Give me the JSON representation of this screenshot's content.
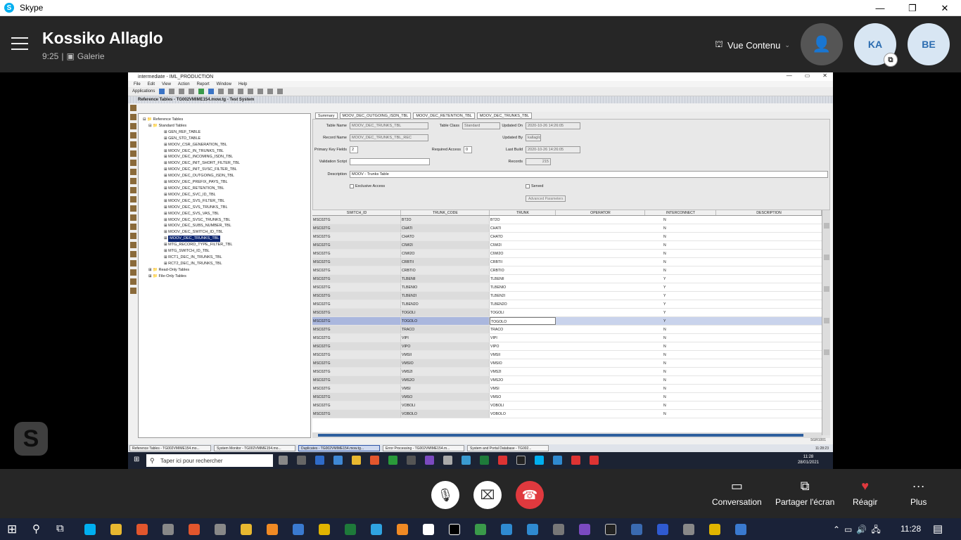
{
  "window": {
    "app_name": "Skype",
    "minimize": "—",
    "maximize": "❐",
    "close": "✕"
  },
  "call": {
    "caller": "Kossiko Allaglo",
    "time": "9:25",
    "view": "Galerie",
    "content_view": "Vue Contenu",
    "avatars": [
      "KA",
      "BE"
    ]
  },
  "shared_app": {
    "title": "intermediate - IML_PRODUCTION",
    "menu": [
      "File",
      "Edit",
      "View",
      "Action",
      "Report",
      "Window",
      "Help"
    ],
    "toolbar_label": "Applications",
    "doc_title": "Reference Tables - TG002VMIME154.mow.tg - Test System",
    "tree": {
      "root": "Reference Tables",
      "group": "Standard Tables",
      "items": [
        "GEN_REF_TABLE",
        "GEN_STD_TABLE",
        "MOOV_CSR_GENERATION_TBL",
        "MOOV_DEC_IN_TRUNKS_TBL",
        "MOOV_DEC_INCOMING_ISDN_TBL",
        "MOOV_DEC_INIT_SHORT_FILTER_TBL",
        "MOOV_DEC_INIT_SVSC_FILTER_TBL",
        "MOOV_DEC_OUTGOING_ISDN_TBL",
        "MOOV_DEC_PREFIX_PAYS_TBL",
        "MOOV_DEC_RETENTION_TBL",
        "MOOV_DEC_SVC_ID_TBL",
        "MOOV_DEC_SVS_FILTER_TBL",
        "MOOV_DEC_SVS_TRUNKS_TBL",
        "MOOV_DEC_SVS_VAS_TBL",
        "MOOV_DEC_SVSC_TRUNKS_TBL",
        "MOOV_DEC_SUBS_NUMBER_TBL",
        "MOOV_DEC_SWITCH_ID_TBL",
        "MOOV_DEC_TRUNKS_TBL",
        "MTG_RECORD_TYPE_FILTER_TBL",
        "MTG_SWITCH_ID_TBL",
        "RCT1_DEC_IN_TRUNKS_TBL",
        "RCT2_DEC_IN_TRUNKS_TBL"
      ],
      "selected_index": 17,
      "other_groups": [
        "Read-Only Tables",
        "File-Only Tables"
      ]
    },
    "tabs": [
      "Summary",
      "MOOV_DEC_OUTGOING_ISDN_TBL",
      "MOOV_DEC_RETENTION_TBL",
      "MOOV_DEC_TRUNKS_TBL"
    ],
    "form": {
      "table_name_label": "Table Name",
      "table_name": "MOOV_DEC_TRUNKS_TBL",
      "table_class_label": "Table Class",
      "table_class": "Standard",
      "updated_on_label": "Updated On",
      "updated_on": "2020-10-26 14:26:05",
      "record_name_label": "Record Name",
      "record_name": "MOOV_DEC_TRUNKS_TBL_REC",
      "updated_by_label": "Updated By",
      "updated_by": "kallaglo",
      "pk_label": "Primary Key Fields",
      "pk": "2",
      "required_access_label": "Required Access",
      "required_access": "0",
      "last_build_label": "Last Build",
      "last_build": "2020-10-26 14:26:05",
      "validation_label": "Validation Script",
      "validation": "",
      "records_label": "Records",
      "records": "215",
      "description_label": "Description",
      "description": "MOOV - Trunks Table",
      "exclusive_label": "Exclusive Access",
      "served_label": "Served",
      "advanced_label": "Advanced Parameters"
    },
    "grid": {
      "columns": [
        "SWITCH_ID",
        "TRUNK_CODE",
        "TRUNK",
        "OPERATOR",
        "INTERCONNECT",
        "DESCRIPTION"
      ],
      "rows": [
        [
          "MSC02TG",
          "BT2O",
          "BT2O",
          "",
          "N",
          ""
        ],
        [
          "MSC02TG",
          "CHATI",
          "CHATI",
          "",
          "N",
          ""
        ],
        [
          "MSC02TG",
          "CHATO",
          "CHATO",
          "",
          "N",
          ""
        ],
        [
          "MSC02TG",
          "CIWI2I",
          "CIWI2I",
          "",
          "N",
          ""
        ],
        [
          "MSC02TG",
          "CIWI2O",
          "CIWI2O",
          "",
          "N",
          ""
        ],
        [
          "MSC02TG",
          "CRBTII",
          "CRBTII",
          "",
          "N",
          ""
        ],
        [
          "MSC02TG",
          "CRBTIO",
          "CRBTIO",
          "",
          "N",
          ""
        ],
        [
          "MSC02TG",
          "TLBENII",
          "TLBENII",
          "",
          "Y",
          ""
        ],
        [
          "MSC02TG",
          "TLBENIO",
          "TLBENIO",
          "",
          "Y",
          ""
        ],
        [
          "MSC02TG",
          "TLBEN2I",
          "TLBEN2I",
          "",
          "Y",
          ""
        ],
        [
          "MSC02TG",
          "TLBEN2O",
          "TLBEN2O",
          "",
          "Y",
          ""
        ],
        [
          "MSC02TG",
          "TOGOLI",
          "TOGOLI",
          "",
          "Y",
          ""
        ],
        [
          "MSC02TG",
          "TOGOLO",
          "TOGOLO",
          "",
          "Y",
          ""
        ],
        [
          "MSC02TG",
          "TRACO",
          "TRACO",
          "",
          "N",
          ""
        ],
        [
          "MSC02TG",
          "VIPI",
          "VIPI",
          "",
          "N",
          ""
        ],
        [
          "MSC02TG",
          "VIPO",
          "VIPO",
          "",
          "N",
          ""
        ],
        [
          "MSC02TG",
          "VMSII",
          "VMSII",
          "",
          "N",
          ""
        ],
        [
          "MSC02TG",
          "VMSIO",
          "VMSIO",
          "",
          "N",
          ""
        ],
        [
          "MSC02TG",
          "VMS2I",
          "VMS2I",
          "",
          "N",
          ""
        ],
        [
          "MSC02TG",
          "VMS2O",
          "VMS2O",
          "",
          "N",
          ""
        ],
        [
          "MSC02TG",
          "VMSI",
          "VMSI",
          "",
          "N",
          ""
        ],
        [
          "MSC02TG",
          "VMSO",
          "VMSO",
          "",
          "N",
          ""
        ],
        [
          "MSC02TG",
          "VOBOLI",
          "VOBOLI",
          "",
          "N",
          ""
        ],
        [
          "MSC02TG",
          "VOBOLO",
          "VOBOLO",
          "",
          "N",
          ""
        ]
      ],
      "highlighted_row": 12
    },
    "status": "SGR1001",
    "inner_tabs": [
      "Reference Tables - TG002VMIME154.mo...",
      "System Monitor - TG002VMIME154.mo...",
      "Duplicates - TG002VMIME154.mow.tg...",
      "Error Processing - TG002VMIME154.m...",
      "System and Portal Database - TG002..."
    ],
    "inner_clock": "11:28:23",
    "search_placeholder": "Taper ici pour rechercher",
    "task_time": "11:28",
    "task_date": "28/01/2021"
  },
  "controls": {
    "conversation": "Conversation",
    "share": "Partager l'écran",
    "react": "Réagir",
    "more": "Plus"
  },
  "taskbar": {
    "time": "11:28"
  },
  "colors": {
    "accent": "#00aff0",
    "end_call": "#e0393e",
    "header_bg": "#262626"
  }
}
